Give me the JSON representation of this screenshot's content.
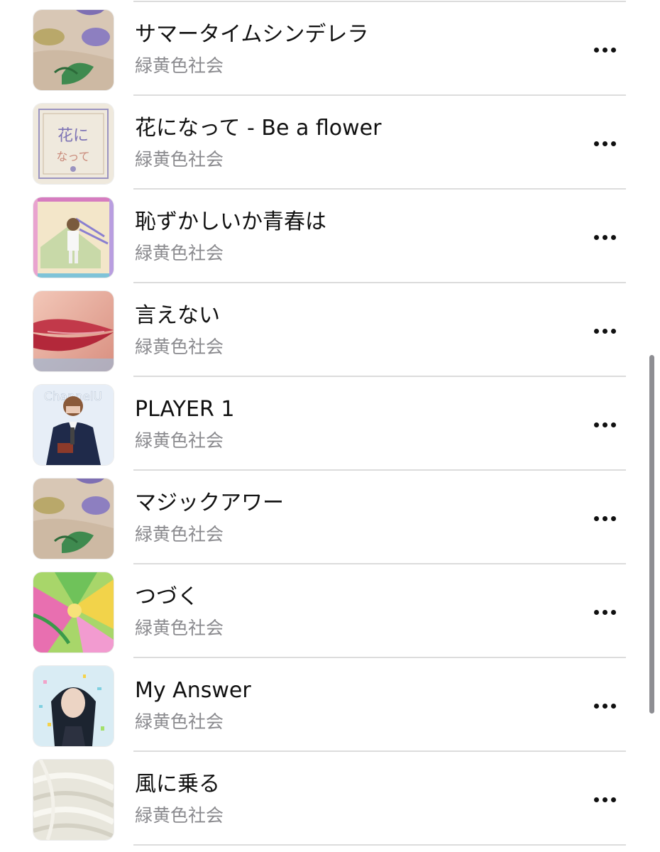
{
  "songs": [
    {
      "title": "サマータイムシンデレラ",
      "artist": "緑黄色社会",
      "artwork_icon": "album-art-leaves"
    },
    {
      "title": "花になって - Be a flower",
      "artist": "緑黄色社会",
      "artwork_icon": "album-art-kanji-frame"
    },
    {
      "title": "恥ずかしいか青春は",
      "artist": "緑黄色社会",
      "artwork_icon": "album-art-running-figure"
    },
    {
      "title": "言えない",
      "artist": "緑黄色社会",
      "artwork_icon": "album-art-lips"
    },
    {
      "title": "PLAYER 1",
      "artist": "緑黄色社会",
      "artwork_icon": "album-art-channel-u"
    },
    {
      "title": "マジックアワー",
      "artist": "緑黄色社会",
      "artwork_icon": "album-art-leaves"
    },
    {
      "title": "つづく",
      "artist": "緑黄色社会",
      "artwork_icon": "album-art-flowers"
    },
    {
      "title": "My Answer",
      "artist": "緑黄色社会",
      "artwork_icon": "album-art-portrait-confetti"
    },
    {
      "title": "風に乗る",
      "artist": "緑黄色社会",
      "artwork_icon": "album-art-white-feathers"
    }
  ],
  "artwork_text": {
    "channel_u": "ChannelU",
    "kanji_a": "花に",
    "kanji_b": "なって"
  },
  "colors": {
    "title": "#111111",
    "subtitle": "#8a8a8e",
    "divider": "#dcdcdc",
    "scrollbar": "#8e8e93"
  },
  "more_icon": "ellipsis-icon"
}
